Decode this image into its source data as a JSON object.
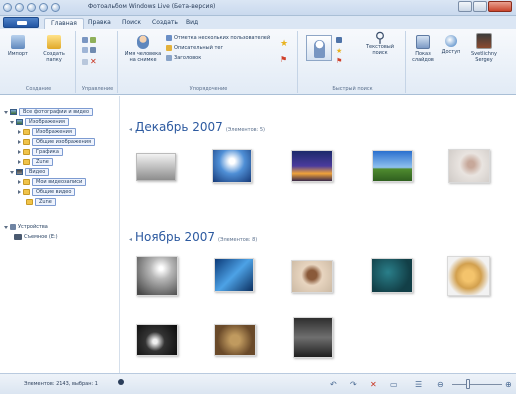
{
  "window": {
    "title": "Фотоальбом Windows Live (Бета-версия)"
  },
  "tabs": [
    {
      "label": "Главная",
      "active": true
    },
    {
      "label": "Правка",
      "active": false
    },
    {
      "label": "Поиск",
      "active": false
    },
    {
      "label": "Создать",
      "active": false
    },
    {
      "label": "Вид",
      "active": false
    }
  ],
  "ribbon": {
    "create": {
      "import_label": "Импорт",
      "new_album_label": "Создать папку",
      "group_label": "Создание"
    },
    "manage": {
      "group_label": "Управление"
    },
    "organize": {
      "tag_people_label": "Имя человека на снимке",
      "row1": "Отметка нескольких пользователей",
      "row2": "Описательный тег",
      "row3": "Заголовок",
      "group_label": "Упорядочение"
    },
    "quickfind": {
      "text_search_label": "Текстовый поиск",
      "group_label": "Быстрый поиск"
    },
    "slideshow_label": "Показ слайдов",
    "share_label": "Доступ",
    "user_label": "Svetlichny Sergey"
  },
  "nav": {
    "all_photos": "Все фотографии и видео",
    "pictures": "Изображения",
    "my_pictures": "Изображения",
    "public_pictures": "Общие изображения",
    "graphics": "Графика",
    "zune1": "Zune",
    "videos": "Видео",
    "my_videos": "Мои видеозаписи",
    "public_videos": "Общие видео",
    "zune2": "Zune",
    "devices": "Устройства",
    "device_item": "Съемное (E:)"
  },
  "groups": [
    {
      "name": "Декабрь 2007",
      "count": "(Элементов: 5)"
    },
    {
      "name": "Ноябрь 2007",
      "count": "(Элементов: 8)"
    }
  ],
  "status": {
    "text": "Элементов: 2143, выбран: 1"
  },
  "colors": {
    "accent": "#2d5aa0",
    "ribbon_bg": "#e2ebf6",
    "nav_highlight": "#eef3fd"
  }
}
